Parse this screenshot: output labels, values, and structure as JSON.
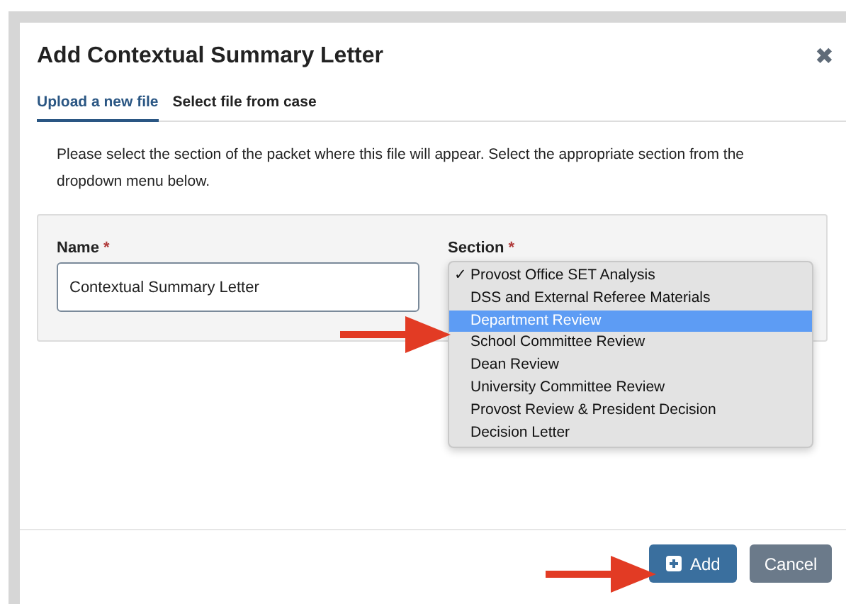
{
  "dialog": {
    "title": "Add Contextual Summary Letter",
    "close_icon": "✖"
  },
  "tabs": [
    {
      "label": "Upload a new file",
      "selected": true
    },
    {
      "label": "Select file from case",
      "selected": false
    }
  ],
  "instructions": "Please select the section of the packet where this file will appear. Select the appropriate section from the dropdown menu below.",
  "form": {
    "name": {
      "label": "Name",
      "required_mark": "*",
      "value": "Contextual Summary Letter"
    },
    "section": {
      "label": "Section",
      "required_mark": "*",
      "check_mark": "✓",
      "options": [
        {
          "label": "Provost Office SET Analysis",
          "selected": true,
          "highlighted": false
        },
        {
          "label": "DSS and External Referee Materials",
          "selected": false,
          "highlighted": false
        },
        {
          "label": "Department Review",
          "selected": false,
          "highlighted": true
        },
        {
          "label": "School Committee Review",
          "selected": false,
          "highlighted": false
        },
        {
          "label": "Dean Review",
          "selected": false,
          "highlighted": false
        },
        {
          "label": "University Committee Review",
          "selected": false,
          "highlighted": false
        },
        {
          "label": "Provost Review & President Decision",
          "selected": false,
          "highlighted": false
        },
        {
          "label": "Decision Letter",
          "selected": false,
          "highlighted": false
        }
      ]
    }
  },
  "buttons": [
    {
      "label": "Add",
      "kind": "primary"
    },
    {
      "label": "Cancel",
      "kind": "secondary"
    }
  ]
}
